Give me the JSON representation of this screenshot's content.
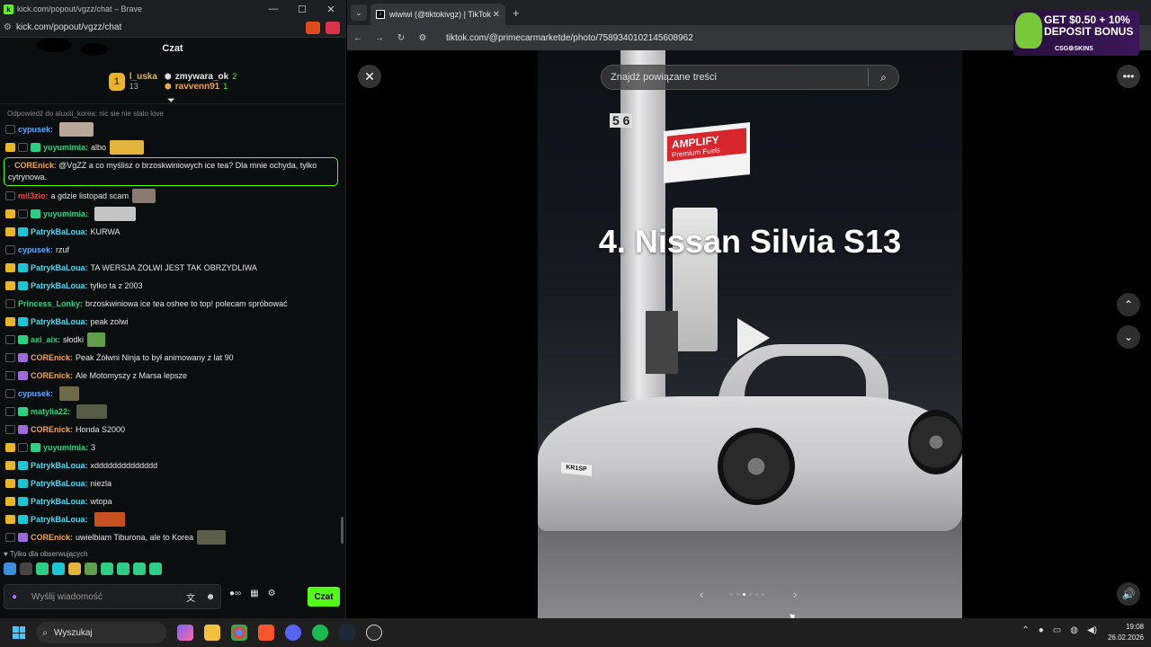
{
  "kick": {
    "window_title": "kick.com/popout/vgzz/chat – Brave",
    "address": "kick.com/popout/vgzz/chat",
    "header_title": "Czat",
    "leaderboard": {
      "rank": "1",
      "top_user": "l_uska",
      "top_sub": "13",
      "users": [
        {
          "name": "zmywara_ok",
          "count": "2"
        },
        {
          "name": "ravvenn91",
          "count": "1"
        }
      ]
    },
    "reply_line": "Odpowiedź do aluxiii_korea: nic sie nie stalo love",
    "messages": [
      {
        "user": "cypusek",
        "text": "",
        "color": "#5aa9ff",
        "badges": [
          "ring"
        ],
        "emote": "#b9a89a"
      },
      {
        "user": "yuyumimia",
        "text": "albo",
        "color": "#2ecf85",
        "badges": [
          "crown",
          "ring",
          "green"
        ],
        "emote": "#e3b43c"
      },
      {
        "user": "mil3zio",
        "text": "a gdzie listopad scam",
        "color": "#ff3d3d",
        "badges": [
          "ring"
        ],
        "emote": "#8a7a70"
      },
      {
        "user": "yuyumimia",
        "text": "",
        "color": "#2ecf85",
        "badges": [
          "crown",
          "ring",
          "green"
        ],
        "emote": "#c4c4c4"
      },
      {
        "user": "PatrykBaLoua",
        "text": "KURWA",
        "color": "#4fd9f0",
        "badges": [
          "crown",
          "cyan"
        ]
      },
      {
        "user": "cypusek",
        "text": "rzuf",
        "color": "#5aa9ff",
        "badges": [
          "ring"
        ]
      },
      {
        "user": "PatrykBaLoua",
        "text": "TA WERSJA ZOLWI JEST TAK OBRZYDLIWA",
        "color": "#4fd9f0",
        "badges": [
          "crown",
          "cyan"
        ]
      },
      {
        "user": "PatrykBaLoua",
        "text": "tylko ta z 2003",
        "color": "#4fd9f0",
        "badges": [
          "crown",
          "cyan"
        ]
      },
      {
        "user": "Princess_Lonky",
        "text": "brzoskwiniowa ice tea oshee to top! polecam spróbować",
        "color": "#2ecf85",
        "badges": [
          "ring"
        ]
      },
      {
        "user": "PatrykBaLoua",
        "text": "peak zolwi",
        "color": "#4fd9f0",
        "badges": [
          "crown",
          "cyan"
        ]
      },
      {
        "user": "axi_aix",
        "text": "słodki",
        "color": "#2ecf85",
        "badges": [
          "ring",
          "green"
        ],
        "emote": "#5f9f4a"
      },
      {
        "user": "COREnick",
        "text": "Peak Żółwni Ninja to był animowany z lat 90",
        "color": "#f0a64a",
        "badges": [
          "ring",
          "purple"
        ]
      },
      {
        "user": "COREnick",
        "text": "Ale Motomyszy z Marsa lepsze",
        "color": "#f0a64a",
        "badges": [
          "ring",
          "purple"
        ]
      },
      {
        "user": "cypusek",
        "text": "",
        "color": "#5aa9ff",
        "badges": [
          "ring"
        ],
        "emote": "#6d6a48"
      },
      {
        "user": "matylia22",
        "text": "",
        "color": "#2ecf85",
        "badges": [
          "ring",
          "green"
        ],
        "emote": "#575a45"
      },
      {
        "user": "COREnick",
        "text": "Honda S2000",
        "color": "#f0a64a",
        "badges": [
          "ring",
          "purple"
        ]
      },
      {
        "user": "yuyumimia",
        "text": "3",
        "color": "#2ecf85",
        "badges": [
          "crown",
          "ring",
          "green"
        ]
      },
      {
        "user": "PatrykBaLoua",
        "text": "xdddddddddddddd",
        "color": "#4fd9f0",
        "badges": [
          "crown",
          "cyan"
        ]
      },
      {
        "user": "PatrykBaLoua",
        "text": "niezla",
        "color": "#4fd9f0",
        "badges": [
          "crown",
          "cyan"
        ]
      },
      {
        "user": "PatrykBaLoua",
        "text": "wtopa",
        "color": "#4fd9f0",
        "badges": [
          "crown",
          "cyan"
        ]
      },
      {
        "user": "PatrykBaLoua",
        "text": "",
        "color": "#4fd9f0",
        "badges": [
          "crown",
          "cyan"
        ],
        "emote": "#c8501e"
      },
      {
        "user": "COREnick",
        "text": "uwielbiam Tiburona, ale to Korea",
        "color": "#f0a64a",
        "badges": [
          "ring",
          "purple"
        ],
        "emote": "#5b5f4a"
      }
    ],
    "highlight": {
      "user": "COREnick",
      "text": "@VgZZ a co myślisz o brzoskwiniowych ice tea? Dla mnie ochyda, tylko cytrynowa."
    },
    "followers_only": "Tylko dla obserwujących",
    "input_placeholder": "Wyślij wiadomość",
    "send_label": "Czat",
    "accent": "#53fc18"
  },
  "browser": {
    "tab_title": "wiwiwi (@tiktokivgz) | TikTok",
    "url": "tiktok.com/@primecarmarketde/photo/7589340102145608962",
    "new_tab": "+"
  },
  "tiktok": {
    "search_placeholder": "Znajdź powiązane treści",
    "heading": "4. Nissan Silvia S13",
    "sign_text": "AMPLIFY",
    "sign_sub": "Premium Fuels",
    "pillar_numbers": "5  6",
    "plate": "KR1SP",
    "dots_total": 6,
    "dots_active": 3
  },
  "ad": {
    "line1": "GET $0.50 + 10%",
    "line2": "DEPOSIT BONUS",
    "brand": "CSG⚙SKINS"
  },
  "taskbar": {
    "search_label": "Wyszukaj",
    "time": "19:08",
    "date": "26.02.2026"
  }
}
